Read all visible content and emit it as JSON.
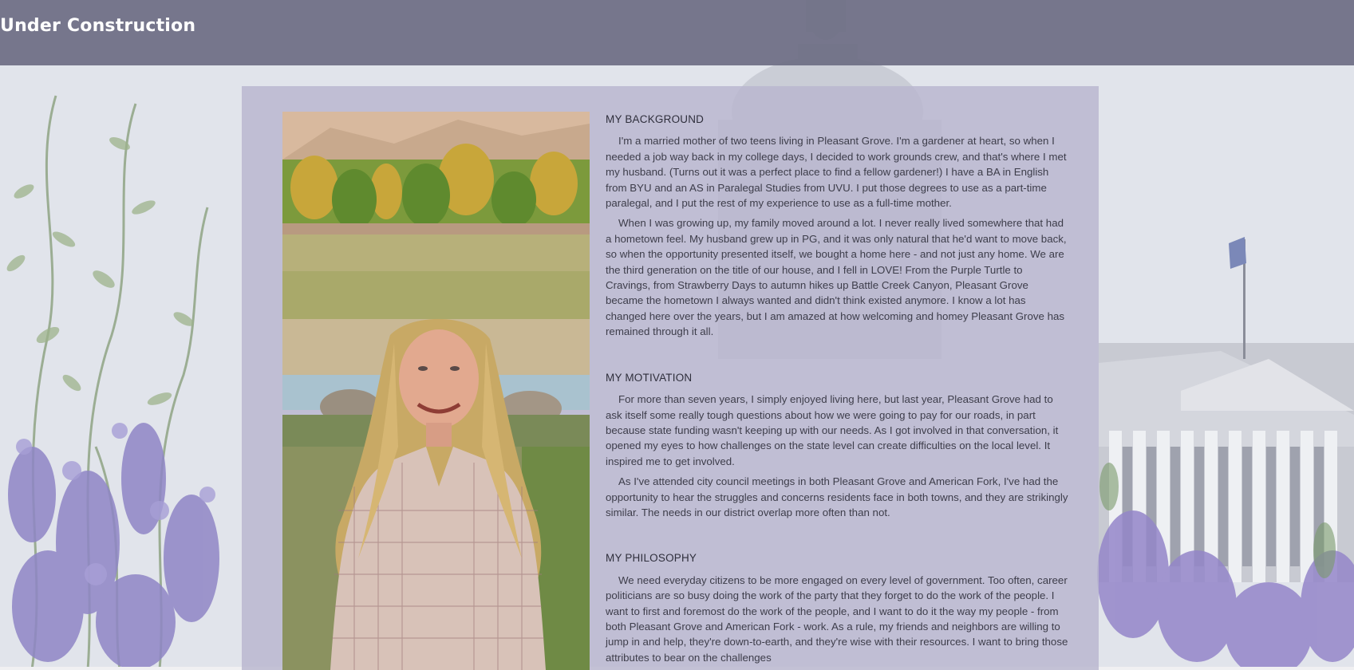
{
  "header": {
    "title": "Under Construction"
  },
  "main": {
    "photo_alt": "Portrait of a woman with long blonde hair standing in front of a lake",
    "sections": [
      {
        "heading": "MY BACKGROUND",
        "paragraphs": [
          "I'm a married mother of two teens living in Pleasant Grove.  I'm a gardener at heart, so when I needed a job way back in my college days, I decided to work grounds crew, and that's where I met my husband.  (Turns out it was a perfect place to find a fellow gardener!) I have a BA in English from BYU and an AS in Paralegal Studies from UVU. I put those degrees to use as a part-time paralegal, and I put the rest of my experience to use as a full-time mother.",
          "When I was growing up, my family moved around a lot. I never really lived somewhere that had a hometown feel. My husband grew up in PG, and it was only natural that he'd want to move back, so when the opportunity presented itself, we bought a home here - and not just any home.  We are the third generation on the title of our house, and I fell in LOVE!  From the Purple Turtle to Cravings, from Strawberry Days to autumn hikes up Battle Creek Canyon, Pleasant Grove became the hometown I always wanted and didn't think existed anymore.  I know a lot has changed here over the years, but I am amazed at how welcoming and homey Pleasant Grove has remained through it all."
        ]
      },
      {
        "heading": "MY MOTIVATION",
        "paragraphs": [
          "For more than seven years, I simply enjoyed living here, but last year, Pleasant Grove had to ask itself some really tough questions about how we were going to pay for our roads, in part because state funding wasn't keeping up with our needs. As I got involved in that conversation, it opened my eyes to how challenges on the state level can create difficulties on the local level.  It inspired me to get involved.",
          "As I've attended city council meetings in both Pleasant Grove and American Fork, I've had the opportunity to hear the struggles and concerns residents face in both towns, and they are strikingly similar. The needs in our district overlap more often than not."
        ]
      },
      {
        "heading": "MY PHILOSOPHY",
        "paragraphs": [
          "We need everyday citizens to be more engaged on every level of government.  Too often, career politicians are so busy doing the work of the party that they forget to do the work of the people.  I want to first and foremost do the work of the people, and I want to do it the way my people - from both Pleasant Grove and American Fork - work.  As a rule, my friends and neighbors are willing to jump in and help, they're down-to-earth, and they're wise with their resources.  I want to bring those attributes to bear on the challenges"
        ]
      }
    ]
  },
  "colors": {
    "header_bg": "#6e6e84",
    "panel_bg": "#b8b6ce",
    "text": "#3d3d4a",
    "title_text": "#ffffff"
  }
}
